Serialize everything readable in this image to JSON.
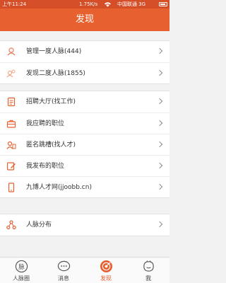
{
  "status_bar": {
    "time": "上午11:24",
    "network_speed": "1.75K/s",
    "carrier": "中国联通 3G"
  },
  "header": {
    "title": "发现"
  },
  "groups": [
    {
      "items": [
        {
          "label": "管理一度人脉(444)",
          "icon": "contacts-icon"
        },
        {
          "label": "发现二度人脉(1855)",
          "icon": "contacts-secondary-icon"
        }
      ]
    },
    {
      "items": [
        {
          "label": "招聘大厅(找工作)",
          "icon": "document-icon"
        },
        {
          "label": "我应聘的职位",
          "icon": "briefcase-icon"
        },
        {
          "label": "匿名跳槽(找人才)",
          "icon": "person-id-icon"
        },
        {
          "label": "我发布的职位",
          "icon": "edit-post-icon"
        },
        {
          "label": "九博人才网(jjoobb.cn)",
          "icon": "mobile-icon"
        }
      ]
    },
    {
      "items": [
        {
          "label": "人脉分布",
          "icon": "network-icon"
        }
      ]
    }
  ],
  "tabbar": {
    "tabs": [
      {
        "label": "人脉圈",
        "icon_text": "脉",
        "icon": "circle-icon"
      },
      {
        "label": "消息",
        "icon": "chat-bubble-icon"
      },
      {
        "label": "发现",
        "icon": "compass-icon",
        "active": true
      },
      {
        "label": "我",
        "icon": "profile-icon"
      }
    ]
  },
  "colors": {
    "accent": "#e6612f",
    "status_bar": "#d44e28",
    "background": "#f2f2f2"
  }
}
